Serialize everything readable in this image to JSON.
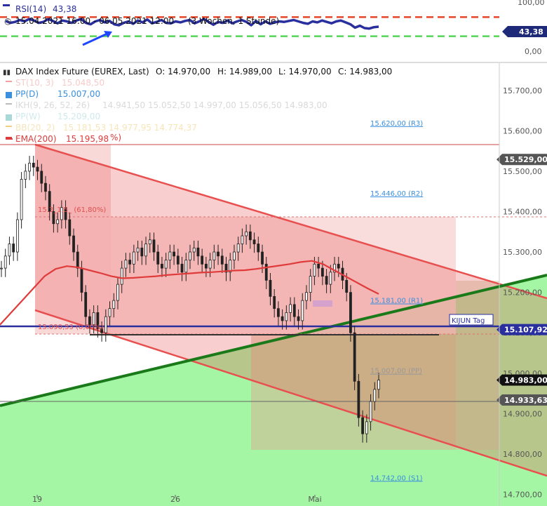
{
  "chart_data": [
    {
      "type": "line",
      "panel": "indicator",
      "legend_rsi": "RSI(14)",
      "rsi_value": "43,38",
      "range_text": "15.04.2021 16:00 - 06.05.2021 12:00",
      "range_note": "(3 Wochen, 1 Stunde)",
      "yticks": [
        "100,00",
        "43,38",
        "0,00"
      ],
      "ylim": [
        0,
        100
      ],
      "levels": [
        70,
        30
      ],
      "series": [
        {
          "name": "RSI(14)",
          "color": "#2a2f9e",
          "values": [
            62,
            58,
            60,
            64,
            61,
            66,
            63,
            58,
            60,
            66,
            62,
            57,
            63,
            61,
            58,
            63,
            66,
            58,
            55,
            61,
            64,
            59,
            62,
            55,
            53,
            58,
            61,
            56,
            63,
            59,
            65,
            57,
            60,
            64,
            58,
            57,
            61,
            59,
            62,
            64,
            57,
            61,
            66,
            60,
            54,
            60,
            58,
            63,
            57,
            61,
            64,
            60,
            53,
            62,
            55,
            61,
            56,
            59,
            61,
            60,
            62,
            64,
            61,
            58,
            56,
            61,
            59,
            63,
            60,
            57,
            61,
            63,
            59,
            55,
            48,
            52,
            47,
            46,
            49,
            50
          ]
        }
      ]
    },
    {
      "type": "candlestick",
      "panel": "main",
      "title": "DAX Index Future (EUREX, Last)",
      "ohlc": {
        "o": "O: 14.970,00",
        "h": "H: 14.989,00",
        "l": "L: 14.970,00",
        "c": "C: 14.983,00"
      },
      "legend": [
        {
          "label": "ST(10, 3)",
          "value": "15.048,50",
          "color": "#f4a0a0"
        },
        {
          "label": "PP(D)",
          "value": "15.007,00",
          "color": "#3a8fde"
        },
        {
          "label": "IKH(9, 26, 52, 26)",
          "value": "14.941,50   15.052,50   14.997,00   15.056,50   14.983,00",
          "color": "#bbbbbb"
        },
        {
          "label": "PP(W)",
          "value": "15.209,00",
          "color": "#a8d8d8"
        },
        {
          "label": "BB(20, 2)",
          "value": "15.181,53   14.977,95   14.774,37",
          "color": "#f0d080"
        },
        {
          "label": "EMA(200)",
          "value": "15.195,98",
          "color": "#e03b3b"
        }
      ],
      "ylim": [
        14680,
        15750
      ],
      "yticks": [
        "15.700,00",
        "15.600,00",
        "15.500,00",
        "15.400,00",
        "15.300,00",
        "15.200,00",
        "15.100,00",
        "15.000,00",
        "14.900,00",
        "14.800,00",
        "14.700,00"
      ],
      "xticks": [
        "19",
        "26",
        "Mai"
      ],
      "price_tags": [
        {
          "text": "15.529,00",
          "value": 15529,
          "color": "#555555"
        },
        {
          "text": "15.107,92",
          "value": 15107.92,
          "color": "#2a2f9e"
        },
        {
          "text": "14.983,00",
          "value": 14983,
          "color": "#111111"
        },
        {
          "text": "14.933,63",
          "value": 14933.63,
          "color": "#555555"
        }
      ],
      "pivot_levels": [
        {
          "text": "15.620,00 (R3)",
          "value": 15620
        },
        {
          "text": "15.446,00 (R2)",
          "value": 15446
        },
        {
          "text": "15.181,00 (R1)",
          "value": 15181
        },
        {
          "text": "15.007,00 (PP)",
          "value": 15007
        },
        {
          "text": "14.742,00 (S1)",
          "value": 14742
        }
      ],
      "fib_levels": [
        {
          "text": "15.3_1,5_ (61,80%)",
          "value": 15361
        },
        {
          "text": "15.090,53 (0,00%)",
          "value": 15091
        }
      ],
      "kijun_label": "KIJUN Tag",
      "ema_label_suffix": "%)",
      "close_series": [
        15260,
        15290,
        15320,
        15300,
        15380,
        15480,
        15500,
        15520,
        15510,
        15500,
        15470,
        15450,
        15400,
        15370,
        15380,
        15410,
        15380,
        15340,
        15300,
        15260,
        15200,
        15140,
        15120,
        15150,
        15110,
        15100,
        15140,
        15160,
        15180,
        15220,
        15260,
        15280,
        15270,
        15300,
        15310,
        15290,
        15320,
        15330,
        15300,
        15270,
        15260,
        15280,
        15300,
        15290,
        15270,
        15250,
        15280,
        15300,
        15310,
        15290,
        15270,
        15260,
        15280,
        15300,
        15290,
        15270,
        15250,
        15280,
        15300,
        15320,
        15340,
        15350,
        15330,
        15320,
        15300,
        15270,
        15230,
        15190,
        15160,
        15140,
        15130,
        15150,
        15170,
        15140,
        15130,
        15180,
        15200,
        15240,
        15270,
        15260,
        15240,
        15220,
        15250,
        15270,
        15260,
        15230,
        15200,
        15100,
        14980,
        14890,
        14850,
        14880,
        14930,
        14960,
        14983
      ],
      "ema_series": [
        15120,
        15150,
        15180,
        15210,
        15240,
        15258,
        15265,
        15262,
        15255,
        15248,
        15240,
        15235,
        15236,
        15238,
        15240,
        15243,
        15245,
        15247,
        15249,
        15250,
        15252,
        15254,
        15255,
        15258,
        15262,
        15266,
        15270,
        15275,
        15278,
        15270,
        15255,
        15240,
        15225,
        15210,
        15196
      ],
      "gradient_colors": {
        "channel": "#e85050",
        "green_fill": "#9af59a",
        "trendline": "#1a7a1a"
      }
    }
  ]
}
